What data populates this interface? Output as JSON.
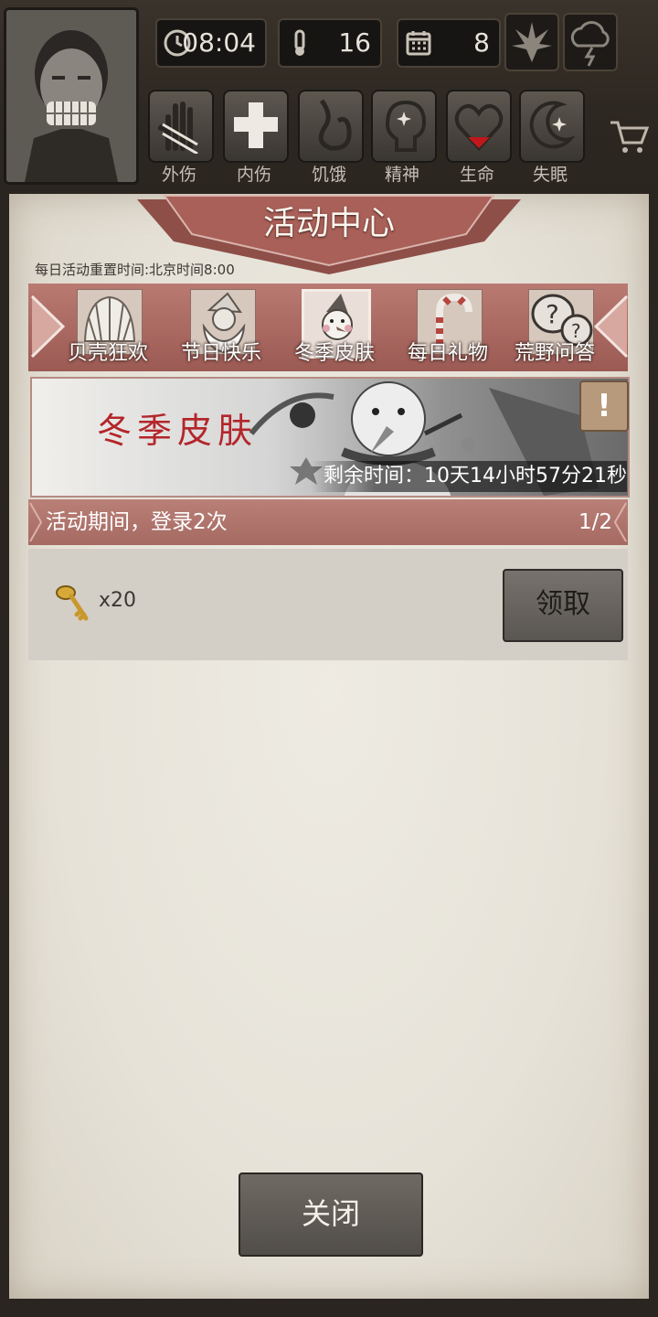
{
  "hud": {
    "time": "08:04",
    "temperature": "16",
    "day": "8",
    "weather_icons": [
      "leaf-icon",
      "storm-cloud-icon"
    ],
    "statuses": [
      {
        "label": "外伤",
        "icon": "hand-icon"
      },
      {
        "label": "内伤",
        "icon": "cross-icon"
      },
      {
        "label": "饥饿",
        "icon": "stomach-icon"
      },
      {
        "label": "精神",
        "icon": "head-icon"
      },
      {
        "label": "生命",
        "icon": "heart-icon"
      },
      {
        "label": "失眠",
        "icon": "moon-icon"
      }
    ]
  },
  "panel": {
    "title": "活动中心",
    "reset_note": "每日活动重置时间:北京时间8:00"
  },
  "tabs": [
    {
      "label": "贝壳狂欢",
      "icon": "shell-icon"
    },
    {
      "label": "节日快乐",
      "icon": "santa-icon"
    },
    {
      "label": "冬季皮肤",
      "icon": "snowman-icon",
      "selected": true
    },
    {
      "label": "每日礼物",
      "icon": "candy-cane-icon"
    },
    {
      "label": "荒野问答",
      "icon": "question-bubble-icon"
    }
  ],
  "banner": {
    "title": "冬季皮肤",
    "countdown": "剩余时间：10天14小时57分21秒",
    "info_symbol": "!"
  },
  "task": {
    "description": "活动期间，登录2次",
    "progress": "1/2",
    "reward_qty": "x20",
    "reward_icon": "key-icon",
    "claim_label": "领取"
  },
  "footer": {
    "close_label": "关闭"
  },
  "colors": {
    "accent_red": "#a0564f",
    "paper": "#e7e3da",
    "banner_title": "#b3262a"
  }
}
